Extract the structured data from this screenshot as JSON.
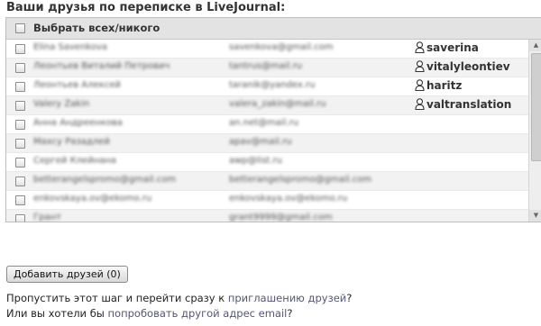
{
  "page": {
    "title": "Ваши друзья по переписке в LiveJournal:"
  },
  "list": {
    "select_all_label": "Выбрать всех/никого",
    "rows": [
      {
        "name": "Elina Savenkova",
        "email": "savenkova@gmail.com",
        "lj_user": "saverina"
      },
      {
        "name": "Леонтьев Виталий Петрович",
        "email": "tantrus@mail.ru",
        "lj_user": "vitalyleontiev"
      },
      {
        "name": "Леонтьев Алексей",
        "email": "taranik@yandex.ru",
        "lj_user": "haritz"
      },
      {
        "name": "Valery Zakin",
        "email": "valera_zakin@mail.ru",
        "lj_user": "valtranslation"
      },
      {
        "name": "Анна Андреенкова",
        "email": "an.net@mail.ru",
        "lj_user": ""
      },
      {
        "name": "Махсу Разадлей",
        "email": "apav@mail.ru",
        "lj_user": ""
      },
      {
        "name": "Сергей Клейнана",
        "email": "awp@list.ru",
        "lj_user": ""
      },
      {
        "name": "betterangelspromo@gmail.com",
        "email": "betterangelspromo@gmail.com",
        "lj_user": ""
      },
      {
        "name": "enkovskaya.ov@ekomo.ru",
        "email": "enkovskaya.ov@ekomo.ru",
        "lj_user": ""
      },
      {
        "name": "Грант",
        "email": "grant9999@gmail.com",
        "lj_user": ""
      }
    ]
  },
  "actions": {
    "add_friends_label": "Добавить друзей (0)"
  },
  "footer": {
    "line1_prefix": "Пропустить этот шаг и перейти сразу к ",
    "line1_link": "приглашению друзей",
    "line1_suffix": "?",
    "line2_prefix": "Или вы хотели бы ",
    "line2_link": "попробовать другой адрес email",
    "line2_suffix": "?"
  },
  "icons": {
    "lj_user": "lj-user-icon",
    "checkbox": "checkbox-icon"
  }
}
